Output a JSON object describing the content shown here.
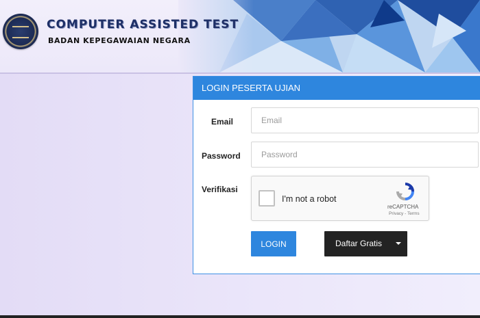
{
  "header": {
    "title": "COMPUTER ASSISTED TEST",
    "subtitle": "BADAN KEPEGAWAIAN NEGARA",
    "logo_icon": "bkn-seal-icon"
  },
  "login_panel": {
    "heading": "LOGIN PESERTA UJIAN",
    "email": {
      "label": "Email",
      "placeholder": "Email",
      "value": ""
    },
    "password": {
      "label": "Password",
      "placeholder": "Password",
      "value": ""
    },
    "verification": {
      "label": "Verifikasi",
      "captcha_text": "I'm not a robot",
      "captcha_brand": "reCAPTCHA",
      "captcha_terms": "Privacy - Terms",
      "checked": false
    },
    "login_button": "LOGIN",
    "register_button": "Daftar Gratis"
  },
  "colors": {
    "accent": "#2e86de",
    "dark_button": "#232323",
    "background": "#e9e4f8",
    "brand_text": "#1e2f66"
  }
}
